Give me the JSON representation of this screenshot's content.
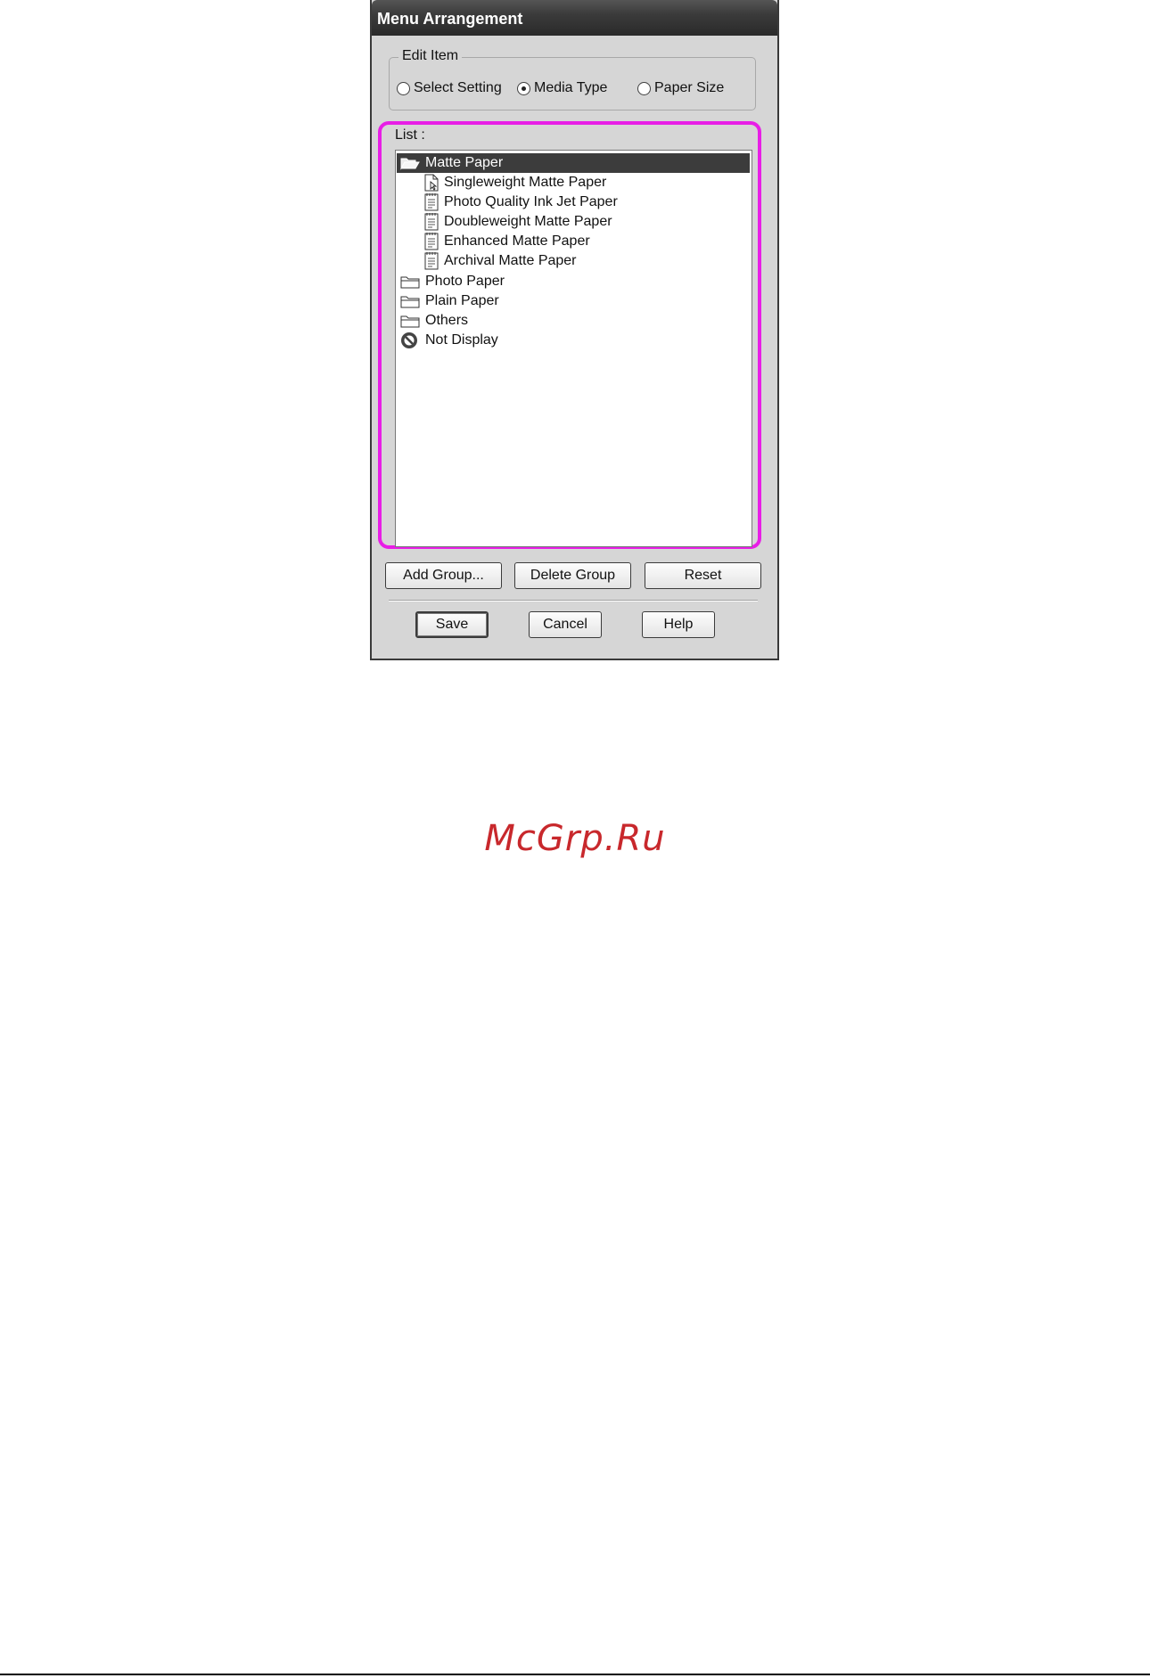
{
  "window": {
    "title": "Menu Arrangement"
  },
  "edit_item": {
    "label": "Edit Item",
    "options": [
      {
        "label": "Select Setting",
        "checked": false
      },
      {
        "label": "Media Type",
        "checked": true
      },
      {
        "label": "Paper Size",
        "checked": false
      }
    ]
  },
  "list": {
    "label": "List :",
    "items": [
      {
        "label": "Matte Paper",
        "icon": "folder-open-icon",
        "selected": true
      },
      {
        "label": "Singleweight Matte Paper",
        "icon": "document-cursor-icon"
      },
      {
        "label": "Photo Quality Ink Jet Paper",
        "icon": "document-icon"
      },
      {
        "label": "Doubleweight Matte Paper",
        "icon": "document-icon"
      },
      {
        "label": "Enhanced Matte Paper",
        "icon": "document-icon"
      },
      {
        "label": "Archival Matte Paper",
        "icon": "document-icon"
      },
      {
        "label": "Photo Paper",
        "icon": "folder-icon"
      },
      {
        "label": "Plain Paper",
        "icon": "folder-icon"
      },
      {
        "label": "Others",
        "icon": "folder-icon"
      },
      {
        "label": "Not Display",
        "icon": "no-display-icon"
      }
    ]
  },
  "group_buttons": {
    "add": "Add Group...",
    "delete": "Delete Group",
    "reset": "Reset"
  },
  "footer_buttons": {
    "save": "Save",
    "cancel": "Cancel",
    "help": "Help"
  },
  "watermark": {
    "text": "McGrp.Ru"
  },
  "colors": {
    "highlight": "#e81ee6",
    "watermark": "#c8282c",
    "selection": "#3c3c3c"
  }
}
